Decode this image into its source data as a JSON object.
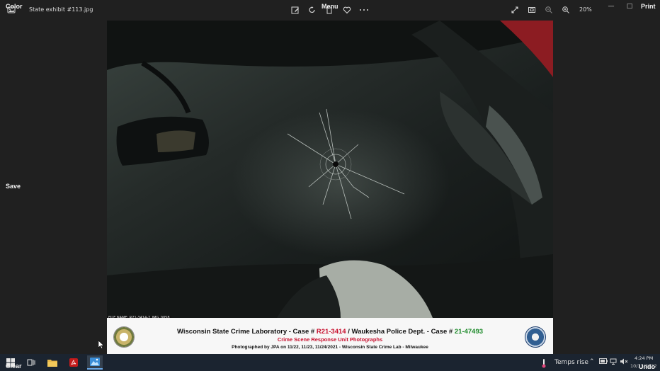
{
  "window": {
    "file_title": "State exhibit #113.jpg",
    "zoom_level": "20%"
  },
  "overlays": {
    "color": "Color",
    "menu": "Menu",
    "print": "Print",
    "save": "Save",
    "clear": "Clear",
    "undo": "Undo"
  },
  "toolbar": {
    "icons": [
      "edit-image-icon",
      "rotate-icon",
      "delete-icon",
      "favorite-icon",
      "more-options-icon",
      "fullscreen-icon",
      "actual-size-icon",
      "zoom-out-icon",
      "zoom-in-icon"
    ]
  },
  "photo": {
    "file_name": "FILE NAME: R21-3414-2_IMG_0058"
  },
  "caption": {
    "lab": "Wisconsin State Crime Laboratory - Case # ",
    "lab_case": "R21-3414",
    "sep": " / Waukesha Police Dept. - Case # ",
    "police_case": "21-47493",
    "unit": "Crime Scene Response Unit Photographs",
    "photographed": "Photographed by JPA on 11/22, 11/23, 11/24/2021 - Wisconsin State Crime Lab - Milwaukee"
  },
  "taskbar": {
    "weather": "Temps rise",
    "time": "4:24 PM",
    "date": "10/13/2022"
  },
  "colors": {
    "accent_red": "#c8102e",
    "accent_green": "#1d8a2a",
    "taskbar": "#1b2430"
  }
}
